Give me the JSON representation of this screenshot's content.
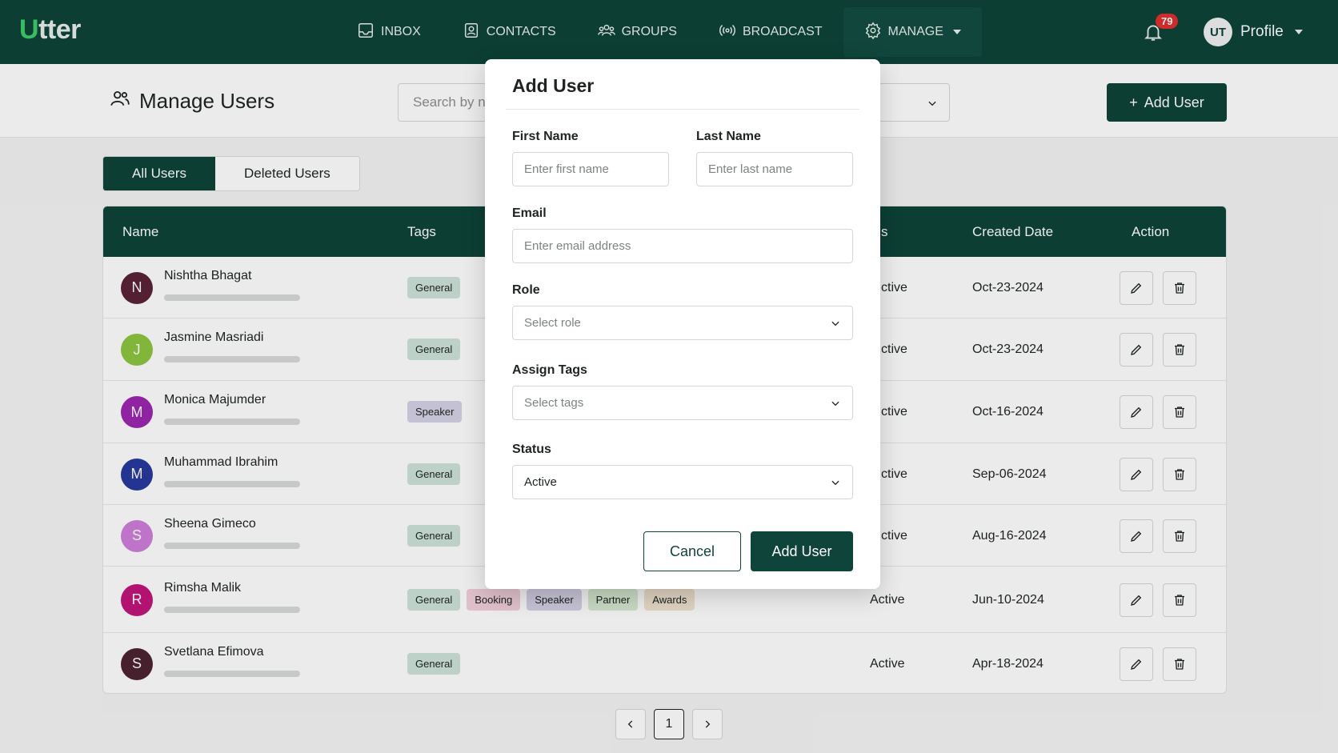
{
  "app": {
    "logo_first": "U",
    "logo_rest": "tter"
  },
  "nav": {
    "items": [
      {
        "label": "INBOX",
        "icon": "inbox-icon"
      },
      {
        "label": "CONTACTS",
        "icon": "contacts-icon"
      },
      {
        "label": "GROUPS",
        "icon": "groups-icon"
      },
      {
        "label": "BROADCAST",
        "icon": "broadcast-icon"
      },
      {
        "label": "MANAGE",
        "icon": "gear-icon"
      }
    ],
    "notification_count": "79",
    "profile_initials": "UT",
    "profile_label": "Profile"
  },
  "header": {
    "title": "Manage Users",
    "search_placeholder": "Search by na",
    "add_user_label": "Add User"
  },
  "tabs": [
    {
      "label": "All Users"
    },
    {
      "label": "Deleted Users"
    }
  ],
  "table": {
    "columns": [
      "Name",
      "Tags",
      "s",
      "Created Date",
      "Action"
    ],
    "rows": [
      {
        "initial": "N",
        "name": "Nishtha Bhagat",
        "tags": [
          "General"
        ],
        "status": "ctive",
        "date": "Oct-23-2024",
        "color": "#5b2338"
      },
      {
        "initial": "J",
        "name": "Jasmine Masriadi",
        "tags": [
          "General"
        ],
        "status": "ctive",
        "date": "Oct-23-2024",
        "color": "#8cc63f"
      },
      {
        "initial": "M",
        "name": "Monica Majumder",
        "tags": [
          "Speaker"
        ],
        "status": "ctive",
        "date": "Oct-16-2024",
        "color": "#9c27b0"
      },
      {
        "initial": "M",
        "name": "Muhammad Ibrahim",
        "tags": [
          "General"
        ],
        "status": "ctive",
        "date": "Sep-06-2024",
        "color": "#283a9e"
      },
      {
        "initial": "S",
        "name": "Sheena Gimeco",
        "tags": [
          "General"
        ],
        "status": "ctive",
        "date": "Aug-16-2024",
        "color": "#cf7ed9"
      },
      {
        "initial": "R",
        "name": "Rimsha Malik",
        "tags": [
          "General",
          "Booking",
          "Speaker",
          "Partner",
          "Awards"
        ],
        "status": "Active",
        "date": "Jun-10-2024",
        "color": "#c2157a"
      },
      {
        "initial": "S",
        "name": "Svetlana Efimova",
        "tags": [
          "General"
        ],
        "status": "Active",
        "date": "Apr-18-2024",
        "color": "#4e2332"
      }
    ],
    "tag_colors": {
      "General": "#cfe3da",
      "Speaker": "#d6d2e6",
      "Booking": "#f2d0dc",
      "Partner": "#d7ebd2",
      "Awards": "#f1e3d0"
    }
  },
  "pagination": {
    "current": "1"
  },
  "modal": {
    "title": "Add User",
    "first_name_label": "First Name",
    "first_name_placeholder": "Enter first name",
    "last_name_label": "Last Name",
    "last_name_placeholder": "Enter last name",
    "email_label": "Email",
    "email_placeholder": "Enter email address",
    "role_label": "Role",
    "role_placeholder": "Select role",
    "tags_label": "Assign Tags",
    "tags_placeholder": "Select tags",
    "status_label": "Status",
    "status_value": "Active",
    "cancel_label": "Cancel",
    "submit_label": "Add User"
  }
}
